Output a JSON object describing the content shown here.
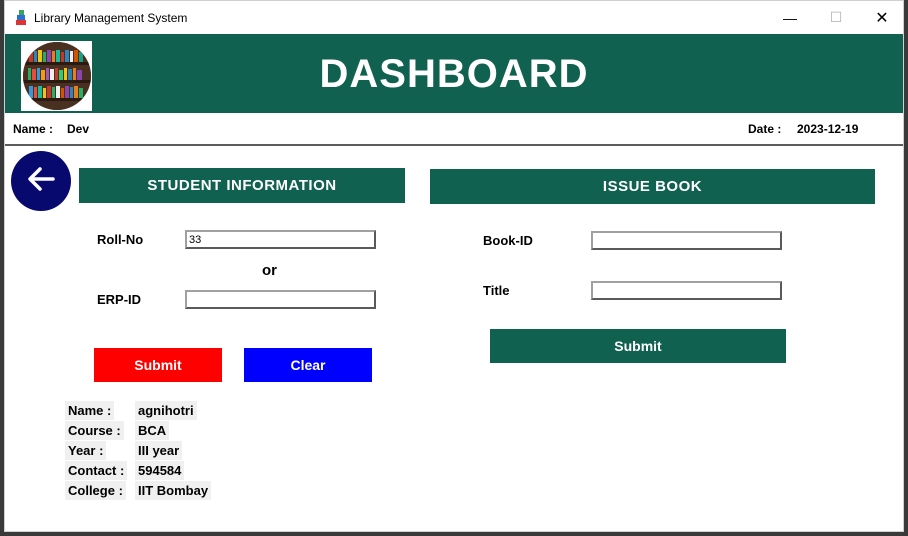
{
  "window": {
    "title": "Library Management System",
    "minimize": "—",
    "maximize": "☐",
    "close": "✕"
  },
  "header": {
    "title": "DASHBOARD"
  },
  "infobar": {
    "name_label": "Name :",
    "name_value": "Dev",
    "date_label": "Date :",
    "date_value": "2023-12-19"
  },
  "student": {
    "heading": "STUDENT  INFORMATION",
    "roll_label": "Roll-No",
    "roll_value": "33",
    "or_text": "or",
    "erp_label": "ERP-ID",
    "erp_value": "",
    "submit_label": "Submit",
    "clear_label": "Clear"
  },
  "details": [
    {
      "label": "Name :",
      "value": "agnihotri"
    },
    {
      "label": "Course :",
      "value": "BCA"
    },
    {
      "label": "Year :",
      "value": "III year"
    },
    {
      "label": "Contact :",
      "value": "594584"
    },
    {
      "label": "College :",
      "value": "IIT Bombay"
    }
  ],
  "issue": {
    "heading": "ISSUE BOOK",
    "bookid_label": "Book-ID",
    "bookid_value": "",
    "title_label": "Title",
    "title_value": "",
    "submit_label": "Submit"
  },
  "colors": {
    "header_green": "#116150",
    "submit_red": "#ff0000",
    "clear_blue": "#0000ff",
    "back_navy": "#08096e"
  },
  "icons": {
    "app": "books-stack-icon",
    "back": "arrow-left-icon",
    "logo": "bookshelf-icon"
  }
}
